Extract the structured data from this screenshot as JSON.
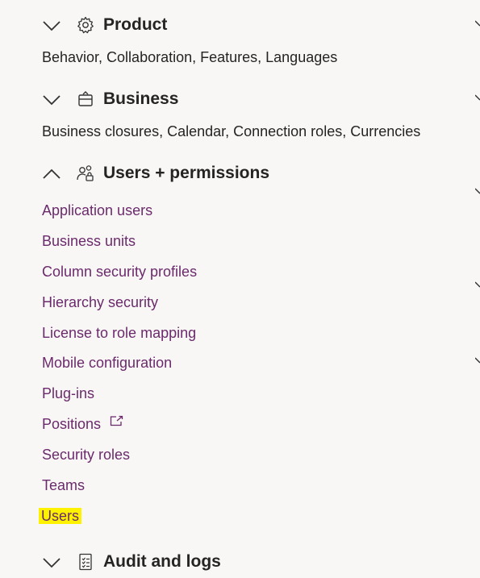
{
  "sections": {
    "product": {
      "title": "Product",
      "description": "Behavior, Collaboration, Features, Languages",
      "icon": "gear-icon",
      "expanded": false
    },
    "business": {
      "title": "Business",
      "description": "Business closures, Calendar, Connection roles, Currencies",
      "icon": "briefcase-icon",
      "expanded": false
    },
    "users_permissions": {
      "title": "Users + permissions",
      "icon": "users-lock-icon",
      "expanded": true,
      "links": [
        {
          "label": "Application users"
        },
        {
          "label": "Business units"
        },
        {
          "label": "Column security profiles"
        },
        {
          "label": "Hierarchy security"
        },
        {
          "label": "License to role mapping"
        },
        {
          "label": "Mobile configuration"
        },
        {
          "label": "Plug-ins"
        },
        {
          "label": "Positions",
          "external": true
        },
        {
          "label": "Security roles"
        },
        {
          "label": "Teams"
        },
        {
          "label": "Users",
          "highlighted": true
        }
      ]
    },
    "audit_logs": {
      "title": "Audit and logs",
      "icon": "checklist-icon",
      "expanded": false
    }
  },
  "colors": {
    "link": "#6b2a6b",
    "highlight": "#fff200",
    "background": "#f8f7f6",
    "text": "#252423"
  }
}
